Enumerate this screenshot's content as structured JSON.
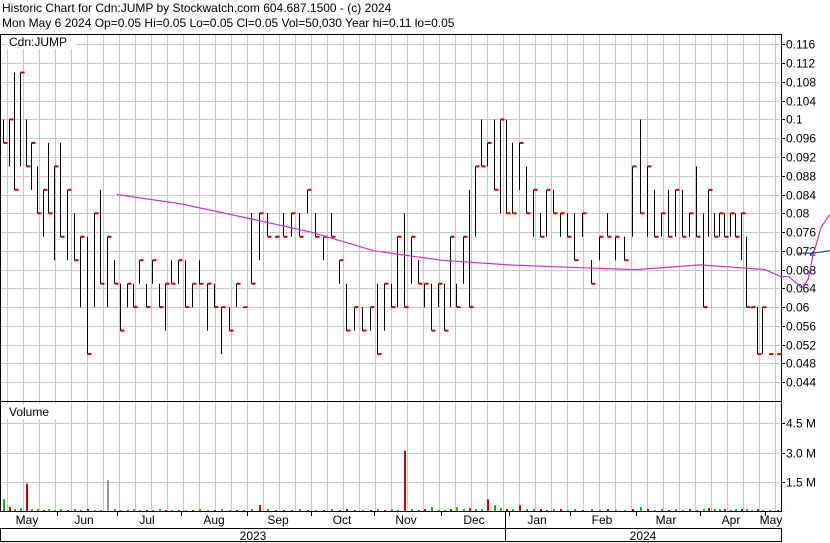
{
  "header": {
    "line1": "Historic Chart for Cdn:JUMP by Stockwatch.com 604.687.1500 - (c) 2024",
    "line2": "Mon May  6 2024  Op=0.05  Hi=0.05  Lo=0.05  Cl=0.05  Vol=50,030  Year hi=0.11  lo=0.05"
  },
  "colors": {
    "price_bar": "#000000",
    "close_tick": "#cc0000",
    "ma_short": "#cc33cc",
    "ma_long": "#1f2db5",
    "volume_up": "#22aa22",
    "volume_down": "#cc0000",
    "volume_flat": "#999999",
    "grid": "#c8c8c8"
  },
  "chart_data": [
    {
      "type": "bar",
      "subtype": "ohlc",
      "panel_label": "Cdn:JUMP",
      "ylim": [
        0.04,
        0.118
      ],
      "y_ticks": [
        "0.116",
        "0.112",
        "0.108",
        "0.104",
        "0.1",
        "0.096",
        "0.092",
        "0.088",
        "0.084",
        "0.08",
        "0.076",
        "0.072",
        "0.068",
        "0.064",
        "0.06",
        "0.056",
        "0.052",
        "0.048",
        "0.044"
      ],
      "x_months": [
        "May",
        "Jun",
        "Jul",
        "Aug",
        "Sep",
        "Oct",
        "Nov",
        "Dec",
        "Jan",
        "Feb",
        "Mar",
        "Apr",
        "May"
      ],
      "x_years": [
        "2023",
        "2024"
      ],
      "bars_by_month": [
        {
          "month": "May",
          "bars": [
            [
              0.095,
              0.1
            ],
            [
              0.09,
              0.1
            ],
            [
              0.085,
              0.11
            ],
            [
              0.09,
              0.11
            ],
            [
              0.09,
              0.1
            ],
            [
              0.085,
              0.095
            ],
            [
              0.08,
              0.09
            ],
            [
              0.075,
              0.085
            ],
            [
              0.08,
              0.095
            ],
            [
              0.07,
              0.09
            ]
          ]
        },
        {
          "month": "Jun",
          "bars": [
            [
              0.075,
              0.095
            ],
            [
              0.07,
              0.085
            ],
            [
              0.07,
              0.08
            ],
            [
              0.06,
              0.075
            ],
            [
              0.05,
              0.075
            ],
            [
              0.06,
              0.08
            ],
            [
              0.065,
              0.085
            ],
            [
              0.06,
              0.075
            ],
            [
              0.065,
              0.07
            ]
          ]
        },
        {
          "month": "Jul",
          "bars": [
            [
              0.055,
              0.065
            ],
            [
              0.06,
              0.065
            ],
            [
              0.06,
              0.065
            ],
            [
              0.065,
              0.07
            ],
            [
              0.06,
              0.065
            ],
            [
              0.065,
              0.07
            ],
            [
              0.06,
              0.065
            ],
            [
              0.055,
              0.065
            ],
            [
              0.065,
              0.07
            ],
            [
              0.065,
              0.07
            ]
          ]
        },
        {
          "month": "Aug",
          "bars": [
            [
              0.06,
              0.07
            ],
            [
              0.06,
              0.065
            ],
            [
              0.065,
              0.07
            ],
            [
              0.055,
              0.065
            ],
            [
              0.06,
              0.065
            ],
            [
              0.05,
              0.06
            ],
            [
              0.055,
              0.06
            ],
            [
              0.06,
              0.065
            ],
            [
              0.06,
              0.06
            ]
          ]
        },
        {
          "month": "Sep",
          "bars": [
            [
              0.065,
              0.08
            ],
            [
              0.07,
              0.08
            ],
            [
              0.075,
              0.08
            ],
            [
              0.075,
              0.075
            ],
            [
              0.075,
              0.08
            ],
            [
              0.075,
              0.08
            ],
            [
              0.075,
              0.08
            ],
            [
              0.08,
              0.085
            ]
          ]
        },
        {
          "month": "Oct",
          "bars": [
            [
              0.075,
              0.08
            ],
            [
              0.07,
              0.075
            ],
            [
              0.075,
              0.08
            ],
            [
              0.065,
              0.07
            ],
            [
              0.055,
              0.065
            ],
            [
              0.055,
              0.06
            ],
            [
              0.055,
              0.06
            ],
            [
              0.055,
              0.06
            ]
          ]
        },
        {
          "month": "Nov",
          "bars": [
            [
              0.05,
              0.065
            ],
            [
              0.055,
              0.065
            ],
            [
              0.06,
              0.065
            ],
            [
              0.06,
              0.075
            ],
            [
              0.06,
              0.08
            ],
            [
              0.065,
              0.075
            ],
            [
              0.065,
              0.07
            ],
            [
              0.06,
              0.065
            ],
            [
              0.055,
              0.065
            ],
            [
              0.06,
              0.065
            ]
          ]
        },
        {
          "month": "Dec",
          "bars": [
            [
              0.055,
              0.065
            ],
            [
              0.06,
              0.075
            ],
            [
              0.06,
              0.065
            ],
            [
              0.065,
              0.075
            ],
            [
              0.06,
              0.085
            ],
            [
              0.075,
              0.09
            ],
            [
              0.09,
              0.1
            ],
            [
              0.09,
              0.095
            ],
            [
              0.085,
              0.1
            ],
            [
              0.08,
              0.1
            ],
            [
              0.08,
              0.1
            ]
          ]
        },
        {
          "month": "Jan",
          "bars": [
            [
              0.08,
              0.095
            ],
            [
              0.085,
              0.095
            ],
            [
              0.08,
              0.09
            ],
            [
              0.075,
              0.085
            ],
            [
              0.075,
              0.08
            ],
            [
              0.075,
              0.085
            ],
            [
              0.08,
              0.085
            ],
            [
              0.075,
              0.08
            ],
            [
              0.075,
              0.08
            ]
          ]
        },
        {
          "month": "Feb",
          "bars": [
            [
              0.07,
              0.08
            ],
            [
              0.075,
              0.08
            ],
            [
              0.065,
              0.07
            ],
            [
              0.07,
              0.075
            ],
            [
              0.075,
              0.08
            ],
            [
              0.07,
              0.075
            ],
            [
              0.07,
              0.075
            ],
            [
              0.075,
              0.09
            ]
          ]
        },
        {
          "month": "Mar",
          "bars": [
            [
              0.08,
              0.1
            ],
            [
              0.075,
              0.09
            ],
            [
              0.075,
              0.085
            ],
            [
              0.075,
              0.08
            ],
            [
              0.075,
              0.085
            ],
            [
              0.075,
              0.085
            ],
            [
              0.075,
              0.085
            ],
            [
              0.075,
              0.08
            ],
            [
              0.075,
              0.09
            ]
          ]
        },
        {
          "month": "Apr",
          "bars": [
            [
              0.06,
              0.08
            ],
            [
              0.075,
              0.085
            ],
            [
              0.075,
              0.08
            ],
            [
              0.075,
              0.08
            ],
            [
              0.075,
              0.08
            ],
            [
              0.075,
              0.08
            ],
            [
              0.075,
              0.08
            ],
            [
              0.07,
              0.08
            ],
            [
              0.06,
              0.075
            ],
            [
              0.06,
              0.06
            ],
            [
              0.05,
              0.06
            ],
            [
              0.05,
              0.06
            ]
          ]
        },
        {
          "month": "May",
          "bars": [
            [
              0.05,
              0.05
            ],
            [
              0.05,
              0.05
            ]
          ]
        }
      ],
      "series": [
        {
          "role": "moving-average-short",
          "points": [
            [
              6,
              0.084
            ],
            [
              7,
              0.082
            ],
            [
              8,
              0.079
            ],
            [
              9,
              0.076
            ],
            [
              10,
              0.072
            ],
            [
              11,
              0.07
            ],
            [
              12,
              0.069
            ],
            [
              13,
              0.0685
            ],
            [
              14,
              0.068
            ],
            [
              15,
              0.069
            ],
            [
              16,
              0.068
            ],
            [
              17,
              0.0665
            ],
            [
              17.5,
              0.0665
            ],
            [
              18,
              0.065
            ],
            [
              18.3,
              0.064
            ],
            [
              18.7,
              0.066
            ],
            [
              19,
              0.071
            ],
            [
              19.5,
              0.077
            ],
            [
              20,
              0.0795
            ],
            [
              20.5,
              0.0805
            ],
            [
              21,
              0.081
            ],
            [
              21.5,
              0.083
            ],
            [
              22,
              0.085
            ],
            [
              22.3,
              0.0855
            ],
            [
              22.7,
              0.0845
            ],
            [
              23,
              0.083
            ],
            [
              23.5,
              0.082
            ],
            [
              24,
              0.081
            ],
            [
              24.5,
              0.0805
            ],
            [
              25,
              0.08
            ],
            [
              25.5,
              0.079
            ],
            [
              25.8,
              0.078
            ],
            [
              26,
              0.075
            ],
            [
              26.2,
              0.074
            ]
          ]
        },
        {
          "role": "moving-average-long",
          "points": [
            [
              18,
              0.0715
            ],
            [
              19,
              0.0715
            ],
            [
              20,
              0.072
            ],
            [
              21,
              0.0725
            ],
            [
              22,
              0.073
            ],
            [
              23,
              0.074
            ],
            [
              24,
              0.0745
            ],
            [
              24.5,
              0.0755
            ],
            [
              25,
              0.076
            ],
            [
              25.5,
              0.0755
            ],
            [
              26,
              0.075
            ],
            [
              26.2,
              0.074
            ]
          ]
        }
      ]
    },
    {
      "type": "bar",
      "subtype": "volume",
      "panel_label": "Volume",
      "ylim": [
        0,
        5.6
      ],
      "y_ticks": [
        "4.5 M",
        "3.0 M",
        "1.5 M"
      ],
      "values_by_month": [
        {
          "month": "May",
          "values": [
            0.6,
            0.2,
            0.1,
            0.15,
            1.4,
            0.1,
            0.1,
            0.05,
            0.1,
            0.05
          ]
        },
        {
          "month": "Jun",
          "values": [
            0.1,
            0.05,
            0.1,
            0.05,
            0.1,
            0.05,
            0.05,
            1.6,
            0.1
          ]
        },
        {
          "month": "Jul",
          "values": [
            0.05,
            0.05,
            0.1,
            0.05,
            0.05,
            0.05,
            0.1,
            0.05,
            0.05,
            0.05
          ]
        },
        {
          "month": "Aug",
          "values": [
            0.05,
            0.05,
            0.1,
            0.05,
            0.05,
            0.1,
            0.05,
            0.05,
            0.05
          ]
        },
        {
          "month": "Sep",
          "values": [
            0.1,
            0.3,
            0.1,
            0.05,
            0.05,
            0.05,
            0.1,
            0.05
          ]
        },
        {
          "month": "Oct",
          "values": [
            0.05,
            0.05,
            0.1,
            0.05,
            0.1,
            0.05,
            0.05,
            0.05
          ]
        },
        {
          "month": "Nov",
          "values": [
            0.1,
            0.05,
            0.1,
            0.05,
            3.1,
            0.1,
            0.05,
            0.1,
            0.2,
            0.05
          ]
        },
        {
          "month": "Dec",
          "values": [
            0.05,
            0.1,
            0.2,
            0.1,
            0.15,
            0.1,
            0.1,
            0.6,
            0.3,
            0.15,
            0.1
          ]
        },
        {
          "month": "Jan",
          "values": [
            0.1,
            0.3,
            0.1,
            0.1,
            0.1,
            0.05,
            0.1,
            0.1,
            0.05
          ]
        },
        {
          "month": "Feb",
          "values": [
            0.1,
            0.05,
            0.1,
            0.05,
            0.1,
            0.05,
            0.05,
            0.1
          ]
        },
        {
          "month": "Mar",
          "values": [
            0.2,
            0.1,
            0.05,
            0.1,
            0.05,
            0.1,
            0.05,
            0.1,
            0.05
          ]
        },
        {
          "month": "Apr",
          "values": [
            0.1,
            0.15,
            0.1,
            0.1,
            0.1,
            0.05,
            0.1,
            0.1,
            0.1,
            0.05,
            0.1,
            0.05
          ]
        },
        {
          "month": "May",
          "values": [
            0.05,
            0.05
          ]
        }
      ]
    }
  ]
}
